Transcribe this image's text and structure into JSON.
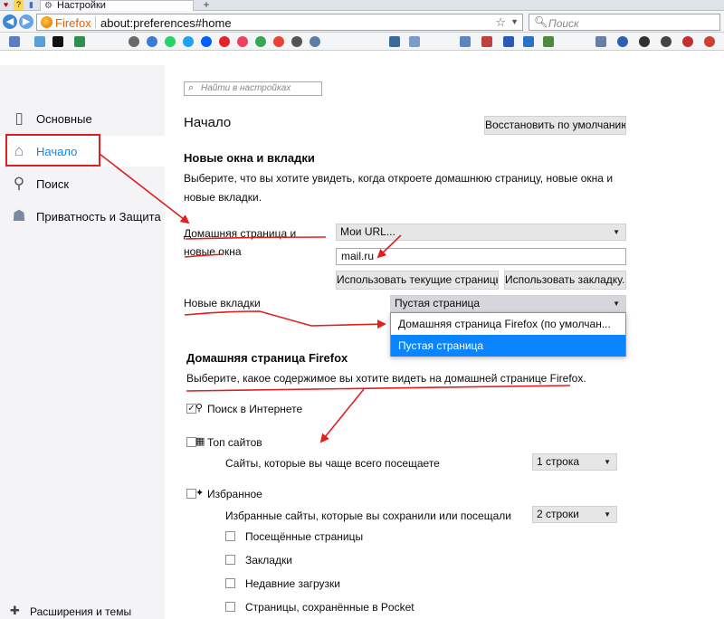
{
  "browser": {
    "tab_title": "Настройки",
    "url_brand": "Firefox",
    "url": "about:preferences#home",
    "search_placeholder": "Поиск"
  },
  "bookmarks": [
    {
      "name": "bookmark-1",
      "color": "#5b7fbf"
    },
    {
      "name": "bookmark-2",
      "color": "#5aa0d8"
    },
    {
      "name": "bookmark-3",
      "color": "#111111"
    },
    {
      "name": "bookmark-4",
      "color": "#2f8f4f"
    },
    {
      "name": "bookmark-5",
      "color": "#6a6a6a"
    },
    {
      "name": "bookmark-6",
      "color": "#3a7bd5"
    },
    {
      "name": "bookmark-7",
      "color": "#25d366"
    },
    {
      "name": "bookmark-8",
      "color": "#1da1f2"
    },
    {
      "name": "bookmark-9",
      "color": "#0061ff"
    },
    {
      "name": "bookmark-10",
      "color": "#e3242b"
    },
    {
      "name": "bookmark-11",
      "color": "#e94560"
    },
    {
      "name": "bookmark-12",
      "color": "#34a853"
    },
    {
      "name": "bookmark-13",
      "color": "#ea4335"
    },
    {
      "name": "bookmark-14",
      "color": "#555555"
    },
    {
      "name": "bookmark-15",
      "color": "#5a7ea6"
    }
  ],
  "sidebar": {
    "items": [
      {
        "label": "Основные",
        "icon": "phone-icon"
      },
      {
        "label": "Начало",
        "icon": "home-icon"
      },
      {
        "label": "Поиск",
        "icon": "magnifier-icon"
      },
      {
        "label": "Приватность и Защита",
        "icon": "mask-icon"
      }
    ],
    "extensions_label": "Расширения и темы"
  },
  "find": {
    "placeholder": "Найти в настройках"
  },
  "home": {
    "title": "Начало",
    "restore_button": "Восстановить по умолчанию",
    "new_windows": {
      "heading": "Новые окна и вкладки",
      "description": "Выберите, что вы хотите увидеть, когда откроете домашнюю страницу, новые окна и новые вкладки.",
      "homepage_label": "Домашняя страница и новые окна",
      "homepage_select": "Мои URL...",
      "homepage_url": "mail.ru",
      "use_current_button": "Использовать текущие страницы",
      "use_bookmark_button": "Использовать закладку...",
      "new_tabs_label": "Новые вкладки",
      "new_tabs_select": "Пустая страница",
      "new_tabs_options": [
        "Домашняя страница Firefox (по умолчан...",
        "Пустая страница"
      ]
    },
    "firefox_home": {
      "heading": "Домашняя страница Firefox",
      "description": "Выберите, какое содержимое вы хотите видеть на домашней странице Firefox.",
      "web_search": "Поиск в Интернете",
      "top_sites": "Топ сайтов",
      "top_sites_desc": "Сайты, которые вы чаще всего посещаете",
      "top_sites_rows": "1 строка",
      "highlights": "Избранное",
      "highlights_desc": "Избранные сайты, которые вы сохранили или посещали",
      "highlights_rows": "2 строки",
      "highlight_options": [
        "Посещённые страницы",
        "Закладки",
        "Недавние загрузки",
        "Страницы, сохранённые в Pocket"
      ]
    }
  },
  "colors": {
    "accent": "#0a84ff",
    "annotation": "#e02020"
  }
}
